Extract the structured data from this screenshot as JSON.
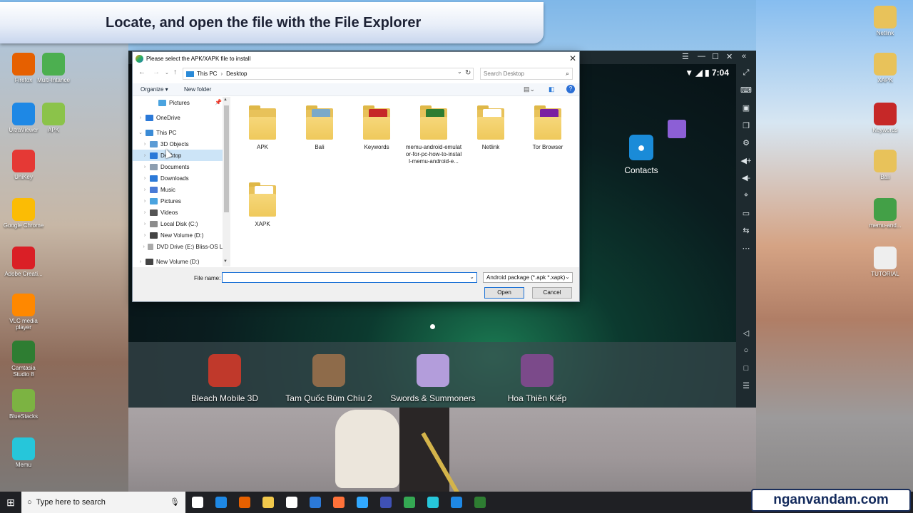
{
  "banner": {
    "title": "Locate, and open the file with the File Explorer"
  },
  "desktop_left": [
    {
      "label": "Firefox",
      "color": "#e66000"
    },
    {
      "label": "Multi-Intance",
      "color": "#4caf50"
    },
    {
      "label": "UltraViewer",
      "color": "#1e88e5"
    },
    {
      "label": "APK",
      "color": "#8bc34a"
    },
    {
      "label": "UniKey",
      "color": "#e53935"
    },
    {
      "label": "Google Chrome",
      "color": "#fbbc05"
    },
    {
      "label": "Adobe Creati...",
      "color": "#da1f26"
    },
    {
      "label": "VLC media player",
      "color": "#ff8800"
    },
    {
      "label": "Camtasia Studio 8",
      "color": "#2e7d32"
    },
    {
      "label": "BlueStacks",
      "color": "#7cb342"
    },
    {
      "label": "Memu",
      "color": "#26c6da"
    }
  ],
  "desktop_right": [
    {
      "label": "Netlink",
      "color": "#e8c25a"
    },
    {
      "label": "XAPK",
      "color": "#e8c25a"
    },
    {
      "label": "Keywords",
      "color": "#c62828"
    },
    {
      "label": "Bali",
      "color": "#e8c25a"
    },
    {
      "label": "memu-and...",
      "color": "#43a047"
    },
    {
      "label": "TUTORIAL",
      "color": "#eeeeee"
    }
  ],
  "memu": {
    "time": "7:04",
    "contacts_label": "Contacts",
    "dock_apps": [
      {
        "label": "Bleach Mobile 3D",
        "color": "#c0392b"
      },
      {
        "label": "Tam Quốc Bùm Chíu 2",
        "color": "#8e6b4a"
      },
      {
        "label": "Swords & Summoners",
        "color": "#b39ddb"
      },
      {
        "label": "Hoa Thiên Kiếp",
        "color": "#7b4a8a"
      }
    ]
  },
  "dialog": {
    "title": "Please select the APK/XAPK file to install",
    "breadcrumb": [
      "This PC",
      "Desktop"
    ],
    "search_placeholder": "Search Desktop",
    "organize_label": "Organize ▾",
    "new_folder_label": "New folder",
    "nav_items": [
      {
        "label": "Pictures",
        "color": "#4aa3df",
        "chev": ""
      },
      {
        "label": "OneDrive",
        "color": "#2b79d8",
        "chev": "›"
      },
      {
        "label": "This PC",
        "color": "#3a8bd6",
        "chev": "⌄"
      },
      {
        "label": "3D Objects",
        "color": "#5b9bd5",
        "chev": "›"
      },
      {
        "label": "Desktop",
        "color": "#2b79d8",
        "chev": "›"
      },
      {
        "label": "Documents",
        "color": "#8d9eb0",
        "chev": "›"
      },
      {
        "label": "Downloads",
        "color": "#2b79d8",
        "chev": "›"
      },
      {
        "label": "Music",
        "color": "#4a7bd6",
        "chev": "›"
      },
      {
        "label": "Pictures",
        "color": "#4aa3df",
        "chev": "›"
      },
      {
        "label": "Videos",
        "color": "#555555",
        "chev": "›"
      },
      {
        "label": "Local Disk (C:)",
        "color": "#8c8c8c",
        "chev": "›"
      },
      {
        "label": "New Volume (D:)",
        "color": "#444444",
        "chev": "›"
      },
      {
        "label": "DVD Drive (E:) Bliss-OS Li",
        "color": "#aaaaaa",
        "chev": "›"
      },
      {
        "label": "New Volume (D:)",
        "color": "#444444",
        "chev": "›"
      }
    ],
    "files": [
      {
        "name": "APK",
        "doc_color": ""
      },
      {
        "name": "Bali",
        "doc_color": "#7aa9c8"
      },
      {
        "name": "Keywords",
        "doc_color": "#c62828"
      },
      {
        "name": "memu-android-emulator-for-pc-how-to-install-memu-android-e...",
        "doc_color": "#2e7d32"
      },
      {
        "name": "Netlink",
        "doc_color": "#ffffff"
      },
      {
        "name": "Tor Browser",
        "doc_color": "#7b1fa2"
      },
      {
        "name": "XAPK",
        "doc_color": "#ffffff"
      }
    ],
    "file_name_label": "File name:",
    "file_name_value": "",
    "filter_value": "Android package (*.apk *.xapk)",
    "open_label": "Open",
    "cancel_label": "Cancel"
  },
  "taskbar": {
    "search_placeholder": "Type here to search",
    "apps": [
      {
        "name": "task-view",
        "color": "#ffffff"
      },
      {
        "name": "edge",
        "color": "#1e88e5"
      },
      {
        "name": "firefox",
        "color": "#e66000"
      },
      {
        "name": "file-explorer",
        "color": "#f2c94c"
      },
      {
        "name": "mail",
        "color": "#ffffff"
      },
      {
        "name": "store",
        "color": "#2b79d8"
      },
      {
        "name": "firefox-2",
        "color": "#ff7139"
      },
      {
        "name": "photoshop",
        "color": "#31a8ff"
      },
      {
        "name": "app-blue",
        "color": "#3f51b5"
      },
      {
        "name": "chrome",
        "color": "#34a853"
      },
      {
        "name": "memu",
        "color": "#26c6da"
      },
      {
        "name": "app-s",
        "color": "#1e88e5"
      },
      {
        "name": "camtasia",
        "color": "#2e7d32"
      }
    ]
  },
  "watermark": "nganvandam.com"
}
